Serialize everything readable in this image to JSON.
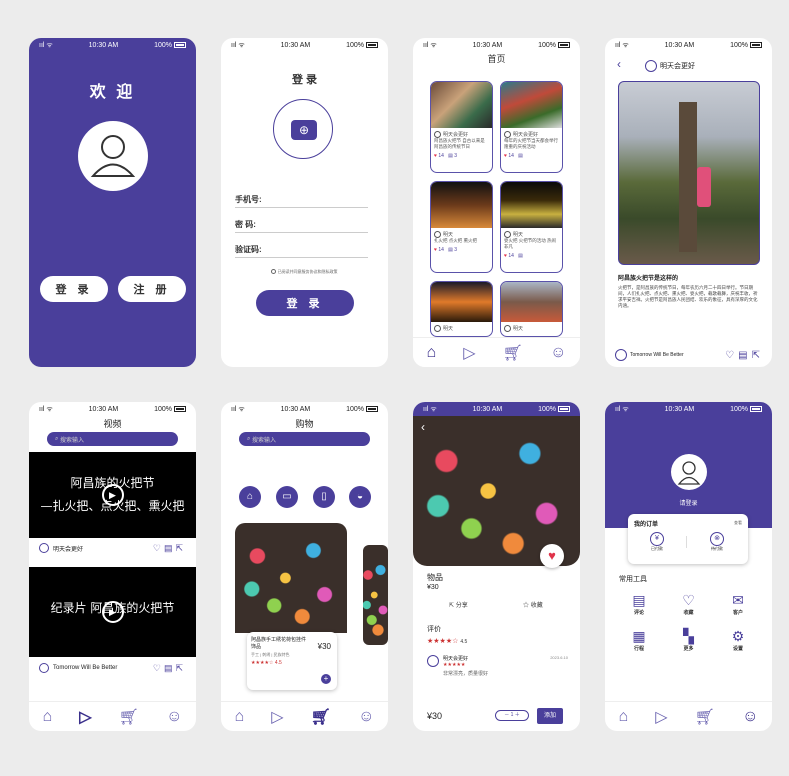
{
  "status": {
    "time": "10:30 AM",
    "battery": "100%",
    "signal": "ııl ᯤ"
  },
  "welcome": {
    "title": "欢 迎",
    "login": "登 录",
    "register": "注 册"
  },
  "login": {
    "title": "登 录",
    "phone": "手机号:",
    "password": "密   码:",
    "code": "验证码:",
    "agree": "已阅读并同意服务协议和隐私政策",
    "submit": "登 录"
  },
  "home": {
    "title": "首页",
    "cards": [
      {
        "user": "明天会更好",
        "text": "阿昌族火把节 自古以来是阿昌族的传统节日",
        "likes": "14",
        "comments": "3"
      },
      {
        "user": "明天会更好",
        "text": "每年的火把节当天都会举行隆重的庆祝活动",
        "likes": "14",
        "comments": ""
      },
      {
        "user": "明天",
        "text": "扎火把 点火把 熏火把",
        "likes": "14",
        "comments": "3"
      },
      {
        "user": "明天",
        "text": "耍火把 火把节的活动 热闹非凡",
        "likes": "14",
        "comments": ""
      },
      {
        "user": "明天",
        "text": "",
        "likes": "",
        "comments": ""
      },
      {
        "user": "明天",
        "text": "",
        "likes": "",
        "comments": ""
      }
    ]
  },
  "detail": {
    "user": "明天会更好",
    "heading": "阿昌族火把节是这样的",
    "body": "火把节，是阿昌族的传统节日，每年农历六月二十四日举行。节日期间，人们扎火把、点火把、熏火把、耍火把，载歌载舞，庆祝丰收，祈求平安吉祥。火把节是阿昌族人民团结、欢乐的象征，具有深厚的文化内涵。",
    "footer_user": "Tomorrow Will Be Better"
  },
  "video": {
    "title": "视频",
    "search": "搜索输入",
    "v1_line1": "阿昌族的火把节",
    "v1_line2": "—扎火把、点火把、熏火把",
    "v1_user": "明天会更好",
    "v2_line1": "纪录片 阿昌族的火把节",
    "v2_user": "Tomorrow Will Be Better"
  },
  "shop": {
    "title": "购物",
    "search": "搜索输入",
    "product_name": "阿昌族手工绣花荷包挂件饰品",
    "tags": "手工 | 刺绣 | 民族特色",
    "price": "¥30",
    "rating": "4.5"
  },
  "product": {
    "name": "物品",
    "price": "¥30",
    "share": "分享",
    "favorite": "收藏",
    "review_title": "评价",
    "rating": "4.5",
    "reviewer": "明天会更好",
    "review_date": "2023.6.10",
    "review_text": "非常漂亮，质量很好",
    "bottom_price": "¥30",
    "qty": "－ 1 ＋",
    "add": "添加"
  },
  "profile": {
    "login_hint": "请登录",
    "orders_title": "我的订单",
    "orders_all": "查看",
    "order_a": "已付款",
    "order_b": "待付款",
    "tools_title": "常用工具",
    "tools": [
      "评论",
      "收藏",
      "客户",
      "行程",
      "更多",
      "设置"
    ]
  },
  "colors": {
    "accent": "#4a3f9b",
    "heart": "#e0334a"
  }
}
